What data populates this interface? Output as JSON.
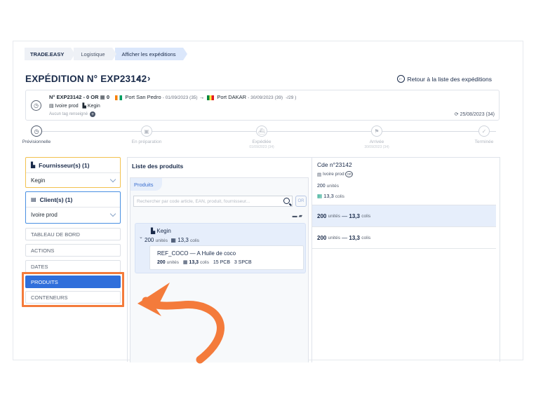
{
  "breadcrumb": [
    "TRADE.EASY",
    "Logistique",
    "Afficher les expéditions"
  ],
  "page": {
    "title": "EXPÉDITION N° EXP23142",
    "prev": "‹",
    "next": "›",
    "back_link": "Retour à la liste des expéditions"
  },
  "shipment": {
    "ref_line": "N° EXP23142 - 0 OR",
    "or_count": "0",
    "origin": "Port San Pedro",
    "origin_date": "- 01/09/2023 (35)",
    "arrow": "→",
    "destination": "Port DAKAR",
    "destination_date": "- 30/09/2023 (39)",
    "delta": "-/29 )",
    "client": "Ivoire prod",
    "supplier": "Kegin",
    "tags": "Aucun tag renseigné",
    "created": "25/08/2023 (34)"
  },
  "timeline": [
    {
      "label": "Prévisionnelle",
      "sub": ""
    },
    {
      "label": "En préparation",
      "sub": ""
    },
    {
      "label": "Expédiée",
      "sub": "01/09/2023 (34)"
    },
    {
      "label": "Arrivée",
      "sub": "30/09/2023 (34)"
    },
    {
      "label": "Terminée",
      "sub": ""
    }
  ],
  "sidebar": {
    "supplier_heading": "Fournisseur(s) (1)",
    "supplier_value": "Kegin",
    "client_heading": "Client(s) (1)",
    "client_value": "Ivoire prod",
    "menu": [
      "TABLEAU DE BORD",
      "ACTIONS",
      "DATES",
      "PRODUITS",
      "CONTENEURS"
    ],
    "active": "PRODUITS"
  },
  "products": {
    "panel_title": "Liste des produits",
    "tab": "Produits",
    "search_placeholder": "Rechercher par code article, EAN, produit, fournisseur...",
    "or_button": "OR",
    "supplier_name": "Kegin",
    "supplier_units": "200",
    "units_word": "unités",
    "supplier_colis": "13,3",
    "colis_word": "colis",
    "item_ref": "REF_COCO — A Huile de coco",
    "item_units": "200",
    "item_colis": "13,3",
    "item_pcb": "15 PCB",
    "item_spcb": "3 SPCB"
  },
  "order": {
    "title": "Cde n°23142",
    "client": "Ivoire prod",
    "badge": "OR",
    "units": "200",
    "units_word": "unités",
    "colis": "13,3",
    "colis_word": "colis",
    "rows": [
      {
        "units": "200",
        "colis": "13,3"
      },
      {
        "units": "200",
        "colis": "13,3"
      }
    ]
  },
  "colors": {
    "accent": "#2f6fdb",
    "highlight": "#f47b3b",
    "supplier_border": "#f2c14e",
    "client_border": "#4a90e2"
  }
}
